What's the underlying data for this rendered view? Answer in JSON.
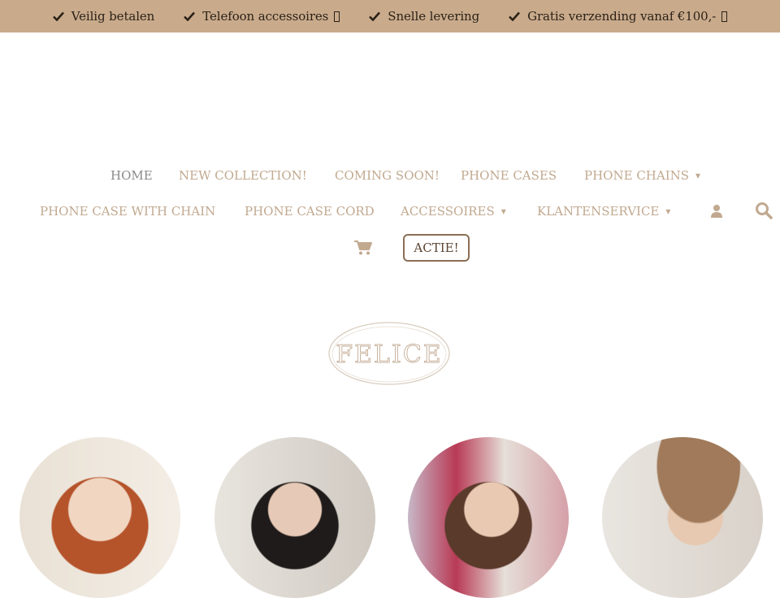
{
  "topbar": {
    "items": [
      {
        "label": "Veilig betalen",
        "has_box": false
      },
      {
        "label": "Telefoon accessoires",
        "has_box": true
      },
      {
        "label": "Snelle levering",
        "has_box": false
      },
      {
        "label": "Gratis verzending vanaf €100,-",
        "has_box": true
      }
    ],
    "icon": "check-icon",
    "background": "#c9ab8c"
  },
  "nav": {
    "row1": [
      {
        "label": "HOME",
        "active": true
      },
      {
        "label": "NEW COLLECTION!"
      },
      {
        "label": "COMING SOON!"
      },
      {
        "label": "PHONE CASES"
      },
      {
        "label": "PHONE CHAINS",
        "dropdown": true
      }
    ],
    "row2": [
      {
        "label": "PHONE CASE WITH CHAIN"
      },
      {
        "label": "PHONE CASE CORD"
      },
      {
        "label": "ACCESSOIRES",
        "dropdown": true
      },
      {
        "label": "KLANTENSERVICE",
        "dropdown": true
      }
    ],
    "caret": "▾",
    "account_icon": "user-icon",
    "search_icon": "search-icon",
    "cart_icon": "cart-icon",
    "actie_label": "ACTIE!"
  },
  "logo": {
    "text": "FELICE"
  },
  "colors": {
    "accent": "#c1a990",
    "active": "#8a8a8a",
    "button_border": "#8a6f55"
  }
}
